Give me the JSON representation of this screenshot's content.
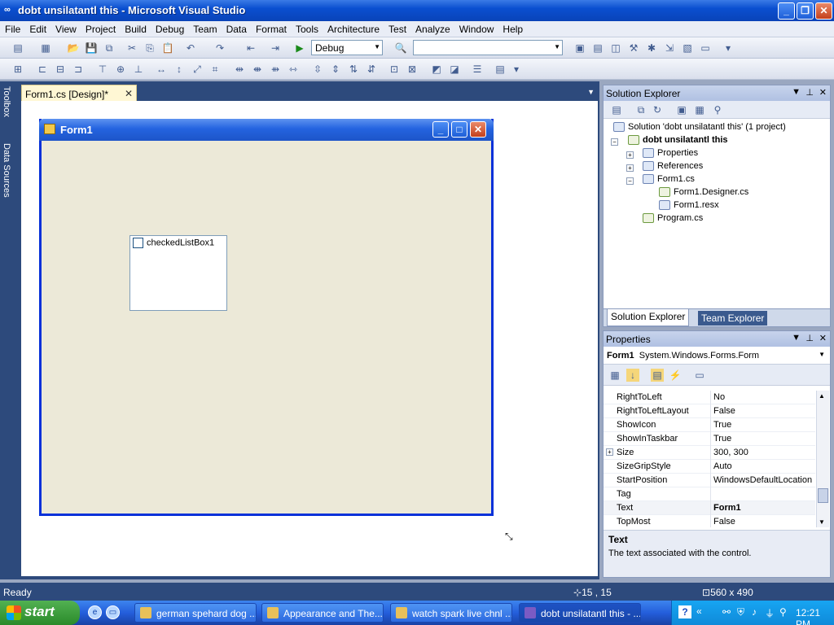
{
  "window": {
    "title": "dobt unsilatantl this - Microsoft Visual Studio"
  },
  "menu": [
    "File",
    "Edit",
    "View",
    "Project",
    "Build",
    "Debug",
    "Team",
    "Data",
    "Format",
    "Tools",
    "Architecture",
    "Test",
    "Analyze",
    "Window",
    "Help"
  ],
  "toolbar": {
    "config": "Debug",
    "platform": ""
  },
  "left_tabs": {
    "toolbox": "Toolbox",
    "data_sources": "Data Sources"
  },
  "document": {
    "tab_label": "Form1.cs [Design]*",
    "form_title": "Form1",
    "checked_list_box": "checkedListBox1"
  },
  "solution_explorer": {
    "title": "Solution Explorer",
    "solution": "Solution 'dobt unsilatantl this' (1 project)",
    "project": "dobt unsilatantl this",
    "items": [
      "Properties",
      "References",
      "Form1.cs",
      "Form1.Designer.cs",
      "Form1.resx",
      "Program.cs"
    ],
    "tab_solution": "Solution Explorer",
    "tab_team": "Team Explorer"
  },
  "properties": {
    "title": "Properties",
    "object_name": "Form1",
    "object_type": "System.Windows.Forms.Form",
    "rows": [
      {
        "name": "RightToLeft",
        "value": "No"
      },
      {
        "name": "RightToLeftLayout",
        "value": "False"
      },
      {
        "name": "ShowIcon",
        "value": "True"
      },
      {
        "name": "ShowInTaskbar",
        "value": "True"
      },
      {
        "name": "Size",
        "value": "300, 300"
      },
      {
        "name": "SizeGripStyle",
        "value": "Auto"
      },
      {
        "name": "StartPosition",
        "value": "WindowsDefaultLocation"
      },
      {
        "name": "Tag",
        "value": ""
      },
      {
        "name": "Text",
        "value": "Form1"
      },
      {
        "name": "TopMost",
        "value": "False"
      }
    ],
    "desc_title": "Text",
    "desc_text": "The text associated with the control."
  },
  "status": {
    "text": "Ready",
    "position": "15 , 15",
    "size": "560 x 490"
  },
  "taskbar": {
    "start": "start",
    "tasks": [
      "german spehard dog ...",
      "Appearance and The...",
      "watch spark live chnl ...",
      "dobt unsilatantl this - ..."
    ],
    "clock": "12:21 PM"
  }
}
